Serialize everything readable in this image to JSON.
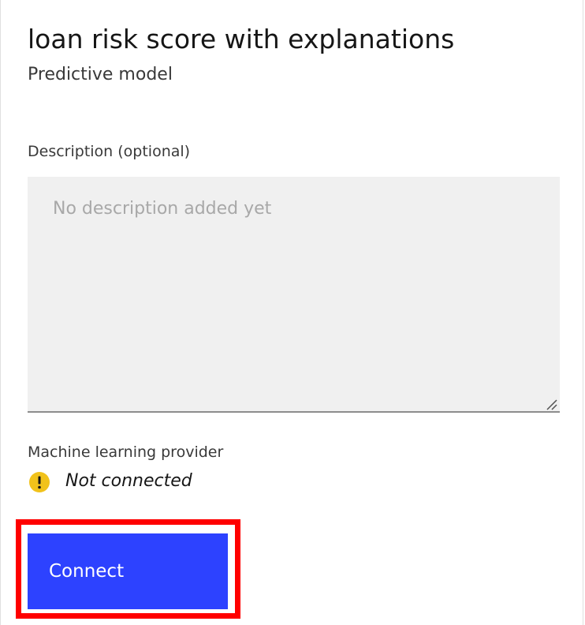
{
  "header": {
    "title": "loan risk score with explanations",
    "subtitle": "Predictive model"
  },
  "description": {
    "label": "Description (optional)",
    "placeholder": "No description added yet",
    "value": ""
  },
  "provider": {
    "label": "Machine learning provider",
    "status_text": "Not connected",
    "status_icon": "warning-icon",
    "status_color": "#f1c21b"
  },
  "actions": {
    "connect_label": "Connect",
    "connect_color": "#2d42ff",
    "highlight_color": "#ff0000"
  }
}
